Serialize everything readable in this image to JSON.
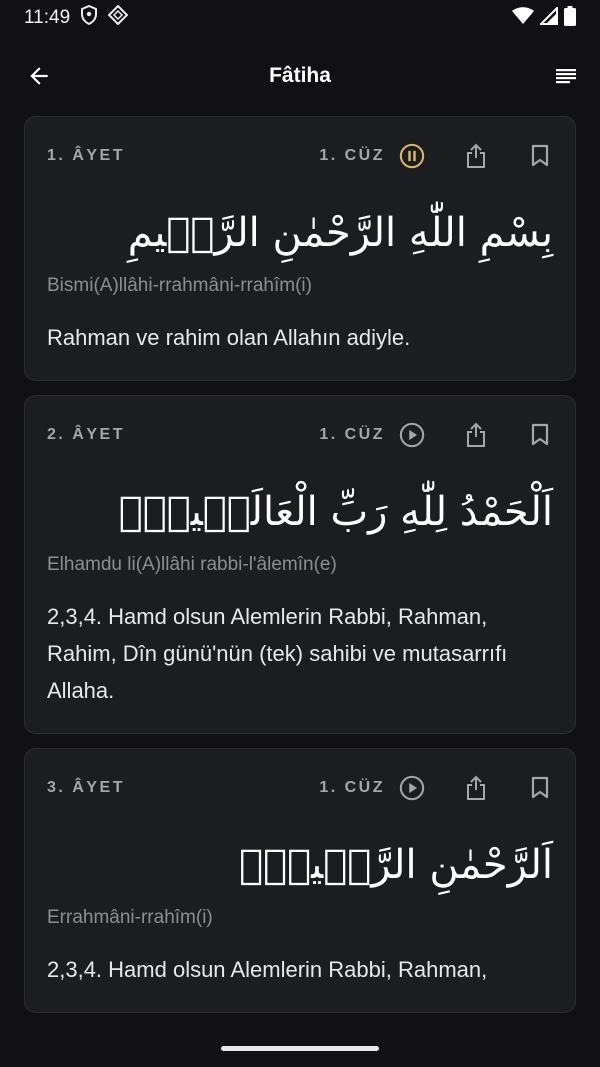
{
  "status": {
    "time": "11:49"
  },
  "header": {
    "title": "Fâtiha"
  },
  "cards": [
    {
      "ayet": "1. ÂYET",
      "cuz": "1. CÜZ",
      "play_state": "pause",
      "arabic": "بِسْمِ اللّٰهِ الرَّحْمٰنِ الرَّح۪يمِ",
      "translit": "Bismi(A)llâhi-rrahmâni-rrahîm(i)",
      "meaning": "Rahman ve rahim olan Allahın adiyle."
    },
    {
      "ayet": "2. ÂYET",
      "cuz": "1. CÜZ",
      "play_state": "play",
      "arabic": "اَلْحَمْدُ لِلّٰهِ رَبِّ الْعَالَم۪ينَۙ",
      "translit": "Elhamdu li(A)llâhi rabbi-l'âlemîn(e)",
      "meaning": "2,3,4. Hamd olsun Alemlerin Rabbi, Rahman, Rahim, Dîn günü'nün (tek) sahibi ve mutasarrıfı Allaha."
    },
    {
      "ayet": "3. ÂYET",
      "cuz": "1. CÜZ",
      "play_state": "play",
      "arabic": "اَلرَّحْمٰنِ الرَّح۪يمِۙ",
      "translit": "Errahmâni-rrahîm(i)",
      "meaning": "2,3,4. Hamd olsun Alemlerin Rabbi, Rahman,"
    }
  ],
  "colors": {
    "accent_playing": "#d9b86a",
    "icon": "#a4a6ab",
    "card_bg": "#1c1d21"
  }
}
